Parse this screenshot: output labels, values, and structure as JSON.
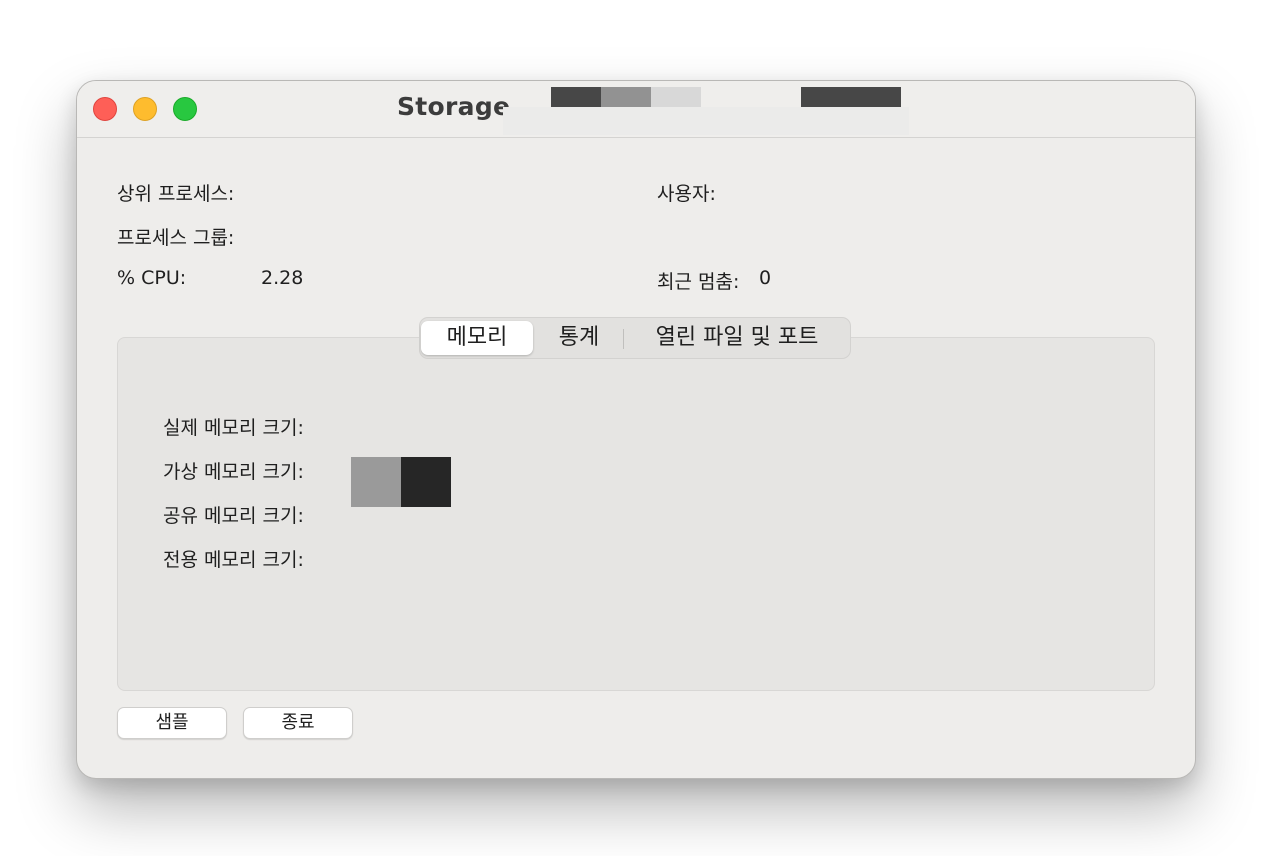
{
  "window": {
    "title": "Storage"
  },
  "info": {
    "parent_process_label": "상위 프로세스:",
    "user_label": "사용자:",
    "process_group_label": "프로세스 그룹:",
    "cpu_label": "% CPU:",
    "cpu_value": "2.28",
    "recent_hangs_label": "최근 멈춤:",
    "recent_hangs_value": "0"
  },
  "tabs": [
    {
      "label": "메모리",
      "selected": true
    },
    {
      "label": "통계",
      "selected": false
    },
    {
      "label": "열린 파일 및 포트",
      "selected": false
    }
  ],
  "memory": {
    "real_label": "실제 메모리 크기:",
    "virtual_label": "가상 메모리 크기:",
    "shared_label": "공유 메모리 크기:",
    "private_label": "전용 메모리 크기:"
  },
  "buttons": {
    "sample": "샘플",
    "quit": "종료"
  },
  "colors": {
    "close": "#fe5f57",
    "minimize": "#febc2e",
    "maximize": "#28c840",
    "window_bg": "#eeedeb"
  }
}
